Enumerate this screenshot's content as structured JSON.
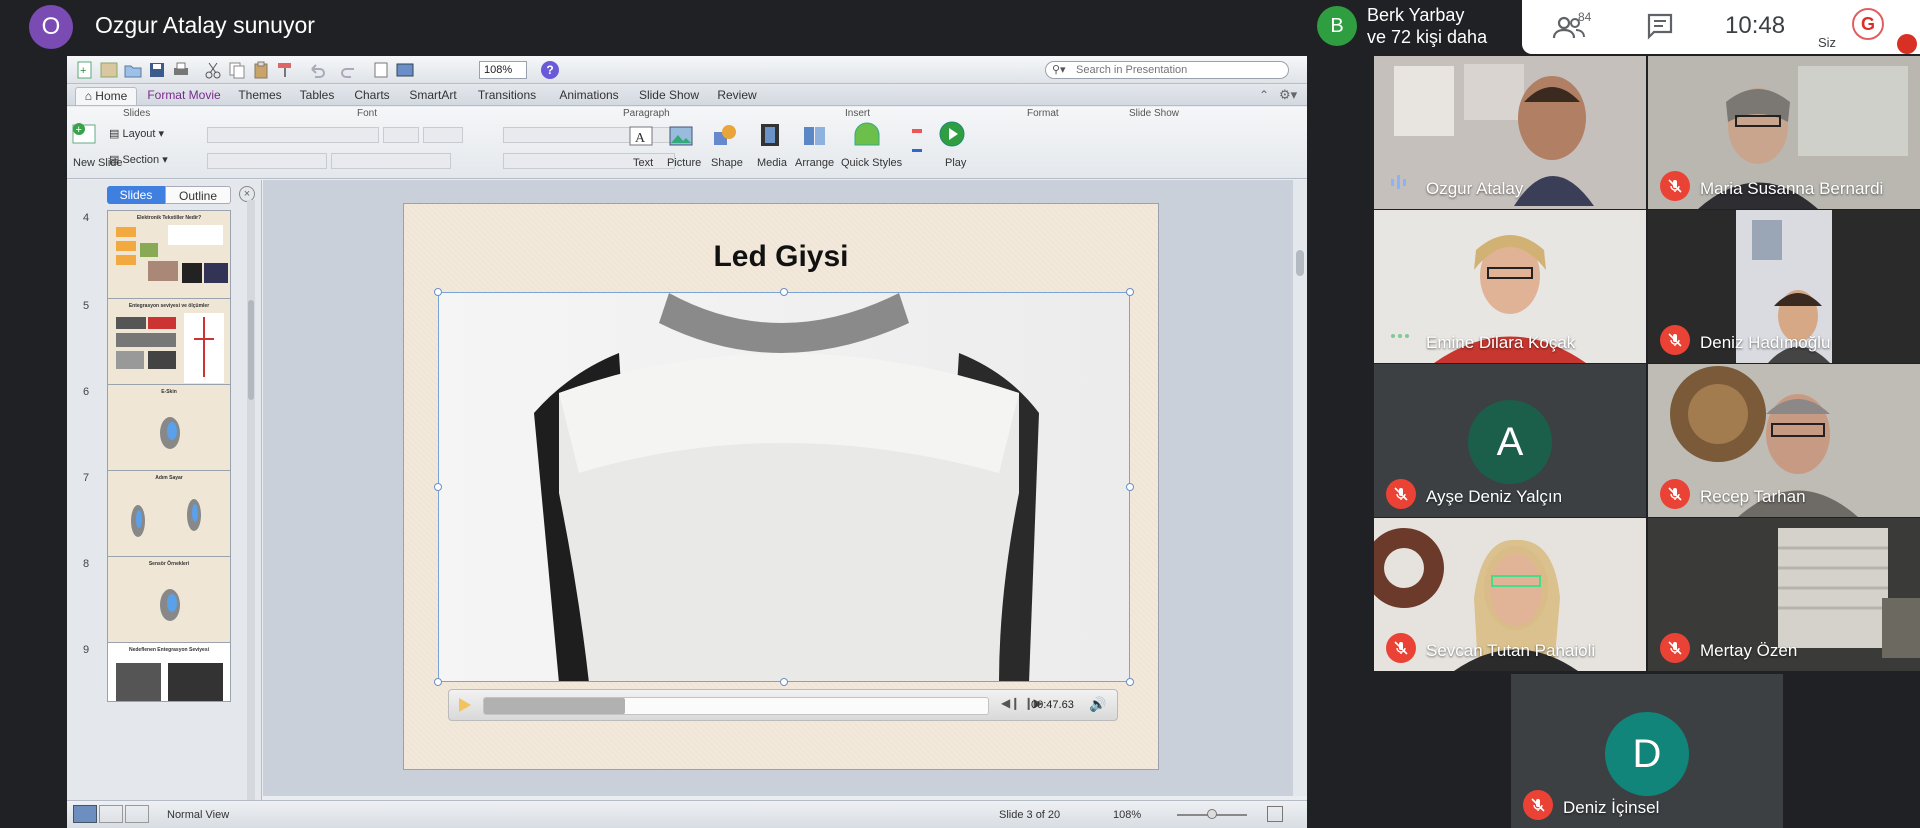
{
  "meet": {
    "presenter_initial": "O",
    "presenter_title": "Ozgur Atalay sunuyor",
    "others_initial": "B",
    "others_line1": "Berk Yarbay",
    "others_line2": "ve 72 kişi daha",
    "people_count": "84",
    "clock": "10:48",
    "self_label": "Siz",
    "self_initial": "G"
  },
  "ppt": {
    "zoom": "108%",
    "search_placeholder": "Search in Presentation",
    "tabs": [
      "Home",
      "Format Movie",
      "Themes",
      "Tables",
      "Charts",
      "SmartArt",
      "Transitions",
      "Animations",
      "Slide Show",
      "Review"
    ],
    "groups": {
      "slides": "Slides",
      "font": "Font",
      "paragraph": "Paragraph",
      "insert": "Insert",
      "format": "Format",
      "slideshow": "Slide Show"
    },
    "ribbon": {
      "new_slide": "New Slide",
      "layout": "Layout",
      "section": "Section",
      "text": "Text",
      "picture": "Picture",
      "shape": "Shape",
      "media": "Media",
      "arrange": "Arrange",
      "quick_styles": "Quick Styles",
      "play": "Play"
    },
    "pane": {
      "slides_tab": "Slides",
      "outline_tab": "Outline"
    },
    "thumbnails": [
      {
        "num": "4",
        "title": "Elektronik Tekstiller Nedir?"
      },
      {
        "num": "5",
        "title": "Entegrasyon seviyesi ve ölçümler"
      },
      {
        "num": "6",
        "title": "E-Skin"
      },
      {
        "num": "7",
        "title": "Adım Sayar"
      },
      {
        "num": "8",
        "title": "Sensör Örnekleri"
      },
      {
        "num": "9",
        "title": "Nedeflenen Entegrasyon Seviyesi"
      }
    ],
    "slide_title": "Led Giysi",
    "video_time": "00:47.63",
    "video_progress": 0.28,
    "status_view": "Normal View",
    "status_slide": "Slide 3 of 20",
    "status_zoom": "108%"
  },
  "participants": [
    {
      "name": "Ozgur Atalay",
      "muted": false,
      "speaking": true
    },
    {
      "name": "Maria Susanna Bernardi",
      "muted": true
    },
    {
      "name": "Emine Dilara Koçak",
      "muted": false,
      "speaking": true
    },
    {
      "name": "Deniz Hadımoğlu",
      "muted": true
    },
    {
      "name": "Ayşe Deniz Yalçın",
      "muted": true,
      "initial": "A"
    },
    {
      "name": "Recep Tarhan",
      "muted": true
    },
    {
      "name": "Sevcan Tutan Panaioli",
      "muted": true
    },
    {
      "name": "Mertay Özen",
      "muted": true
    },
    {
      "name": "Deniz İçinsel",
      "muted": true,
      "initial": "D"
    }
  ],
  "colors": {
    "presenter_avatar": "#7b4bb4",
    "others_avatar": "#2f9e41",
    "ayse_avatar": "#1b5e4a",
    "deniz_avatar": "#11857a",
    "mic_off": "#ea4335"
  }
}
